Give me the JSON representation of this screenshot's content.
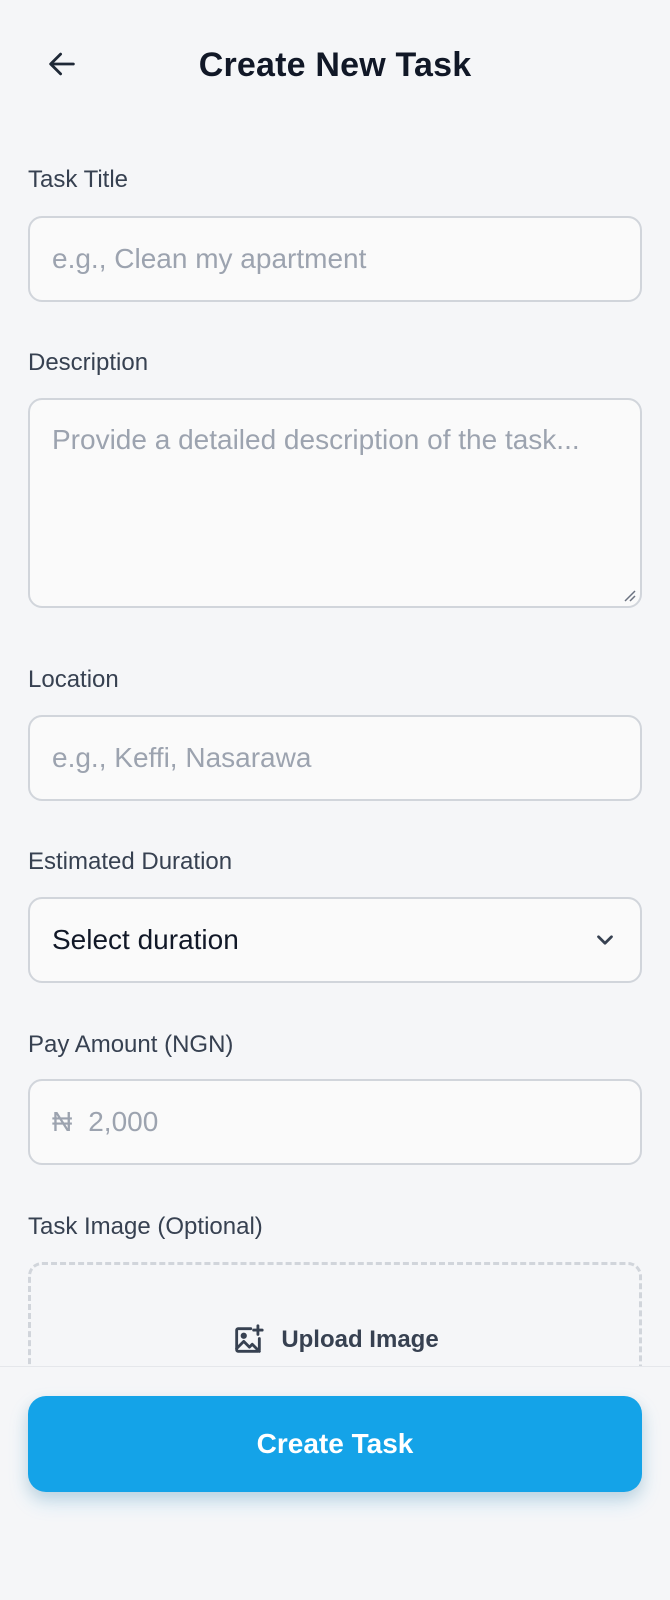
{
  "header": {
    "title": "Create New Task",
    "back_icon": "arrow-left-icon"
  },
  "form": {
    "task_title": {
      "label": "Task Title",
      "placeholder": "e.g., Clean my apartment",
      "value": ""
    },
    "description": {
      "label": "Description",
      "placeholder": "Provide a detailed description of the task...",
      "value": ""
    },
    "location": {
      "label": "Location",
      "placeholder": "e.g., Keffi, Nasarawa",
      "value": ""
    },
    "duration": {
      "label": "Estimated Duration",
      "selected": "Select duration",
      "icon": "chevron-down-icon"
    },
    "pay_amount": {
      "label": "Pay Amount (NGN)",
      "currency_symbol": "₦",
      "placeholder": "2,000",
      "value": ""
    },
    "task_image": {
      "label": "Task Image (Optional)",
      "upload_label": "Upload Image",
      "icon": "image-plus-icon"
    }
  },
  "footer": {
    "submit_label": "Create Task"
  },
  "colors": {
    "background": "#f5f6f8",
    "primary": "#14a3e8",
    "border": "#d1d5db",
    "placeholder": "#9ca3af",
    "label": "#374151",
    "title": "#111827"
  }
}
